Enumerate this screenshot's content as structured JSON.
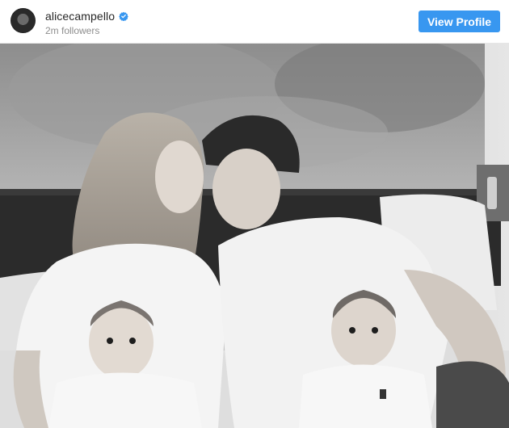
{
  "header": {
    "username": "alicecampello",
    "followers": "2m followers",
    "verified": true,
    "view_profile_label": "View Profile"
  },
  "icons": {
    "avatar": "profile-avatar",
    "verified": "verified-badge-icon"
  },
  "colors": {
    "accent": "#3897f0",
    "username": "#262626",
    "secondary_text": "#8e8e8e"
  },
  "photo": {
    "style": "black-and-white"
  }
}
